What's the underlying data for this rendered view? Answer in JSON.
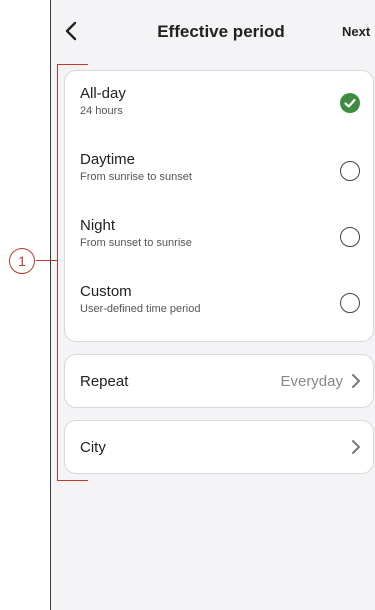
{
  "header": {
    "title": "Effective period",
    "next_label": "Next",
    "back_icon": "chevron-left-icon"
  },
  "options": [
    {
      "label": "All-day",
      "sub": "24 hours",
      "selected": true
    },
    {
      "label": "Daytime",
      "sub": "From sunrise to sunset",
      "selected": false
    },
    {
      "label": "Night",
      "sub": "From sunset to sunrise",
      "selected": false
    },
    {
      "label": "Custom",
      "sub": "User-defined time period",
      "selected": false
    }
  ],
  "repeat": {
    "label": "Repeat",
    "value": "Everyday"
  },
  "city": {
    "label": "City"
  },
  "annotation": {
    "label": "1"
  },
  "colors": {
    "accent_check": "#3d8c40",
    "annotation": "#c0392b",
    "background": "#f4f4f6"
  }
}
